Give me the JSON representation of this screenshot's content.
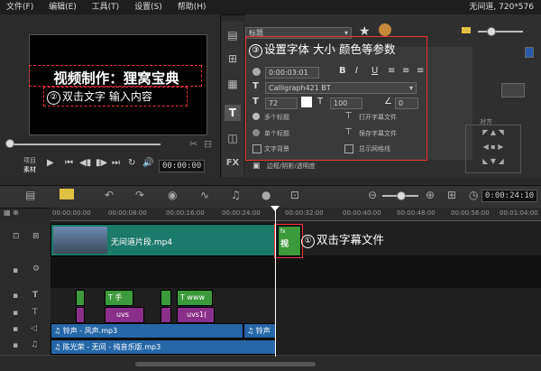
{
  "menu": {
    "items": [
      "文件(F)",
      "编辑(E)",
      "工具(T)",
      "设置(S)",
      "帮助(H)"
    ],
    "title": "无间道, 720*576"
  },
  "preview": {
    "title_text": "视频制作：狸窝宝典",
    "annotation_2": "双击文字 输入内容",
    "annotation_2_num": "②",
    "project_label": "项目",
    "clip_label": "素材",
    "timecode": "00:00:00"
  },
  "options": {
    "preset": "标题",
    "annotation_3_num": "③",
    "annotation_3": "设置字体 大小 颜色等参数",
    "duration": "0:00:03:01",
    "bold": "B",
    "italic": "I",
    "underline": "U",
    "font": "Calligraph421 BT",
    "font_size": "72",
    "line_spacing": "100",
    "rotation": "0",
    "multi_title": "多个标题",
    "single_title": "单个标题",
    "open_subtitle": "打开字幕文件",
    "save_subtitle": "保存字幕文件",
    "text_background": "文字背景",
    "show_grid": "显示网格线",
    "border_shadow": "边框/阴影/透明度",
    "align_label": "对齐",
    "fx_label": "FX"
  },
  "timeline": {
    "timecode": "0:00:24:10",
    "ruler_ticks": [
      "00:00:00:00",
      "00:00:08:00",
      "00:00:16:00",
      "00:00:24:00",
      "00:00:32:00",
      "00:00:40:00",
      "00:00:48:00",
      "00:00:56:00",
      "00:01:04:00"
    ],
    "video_clip": "无间道片段.mp4",
    "title_clip_label": "fx",
    "title_clip_text": "视",
    "annotation_1_num": "①",
    "annotation_1": "双击字幕文件",
    "title_track": [
      {
        "label": "T 手"
      },
      {
        "label": "T www"
      }
    ],
    "overlay_track": [
      {
        "label": "uvs"
      },
      {
        "label": "uvs1("
      }
    ],
    "audio_1": "♫ 铃声 - 风声.mp3",
    "audio_1b": "♫ 铃声",
    "audio_2": "♫ 陈光荣 - 无间 - 纯音乐版.mp3"
  }
}
